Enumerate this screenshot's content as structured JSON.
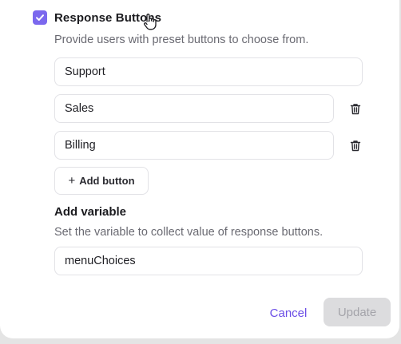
{
  "response_buttons": {
    "enabled": true,
    "title": "Response Buttons",
    "description": "Provide users with preset buttons to choose from.",
    "buttons": [
      {
        "value": "Support",
        "deletable": false
      },
      {
        "value": "Sales",
        "deletable": true
      },
      {
        "value": "Billing",
        "deletable": true
      }
    ],
    "add_button_label": "Add button",
    "add_button_icon": "plus-icon",
    "delete_icon": "trash-icon"
  },
  "variable": {
    "title": "Add variable",
    "description": "Set the variable to collect value of response buttons.",
    "value": "menuChoices"
  },
  "footer": {
    "cancel_label": "Cancel",
    "update_label": "Update",
    "update_enabled": false
  },
  "colors": {
    "accent": "#7b68ee",
    "link": "#6b4ee6",
    "disabled_bg": "#dcdcde",
    "disabled_text": "#a4a4aa"
  }
}
